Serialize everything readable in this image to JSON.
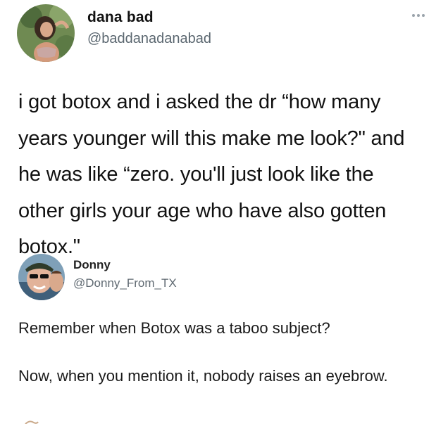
{
  "tweet": {
    "author_name": "dana bad",
    "author_handle": "@baddanadanabad",
    "text": "i got botox and i asked the dr “how many years younger will this make me look?\" and he was like “zero. you'll just look like the other girls your age who have also gotten botox.\"",
    "menu_icon": "more-dots-icon"
  },
  "reply": {
    "author_name": "Donny",
    "author_handle": "@Donny_From_TX",
    "paragraph_1": "Remember when Botox was a taboo subject?",
    "paragraph_2": "Now, when you mention it, nobody raises an eyebrow."
  },
  "colors": {
    "background": "#ffffff",
    "text": "#111111",
    "handle": "#5b6770"
  }
}
